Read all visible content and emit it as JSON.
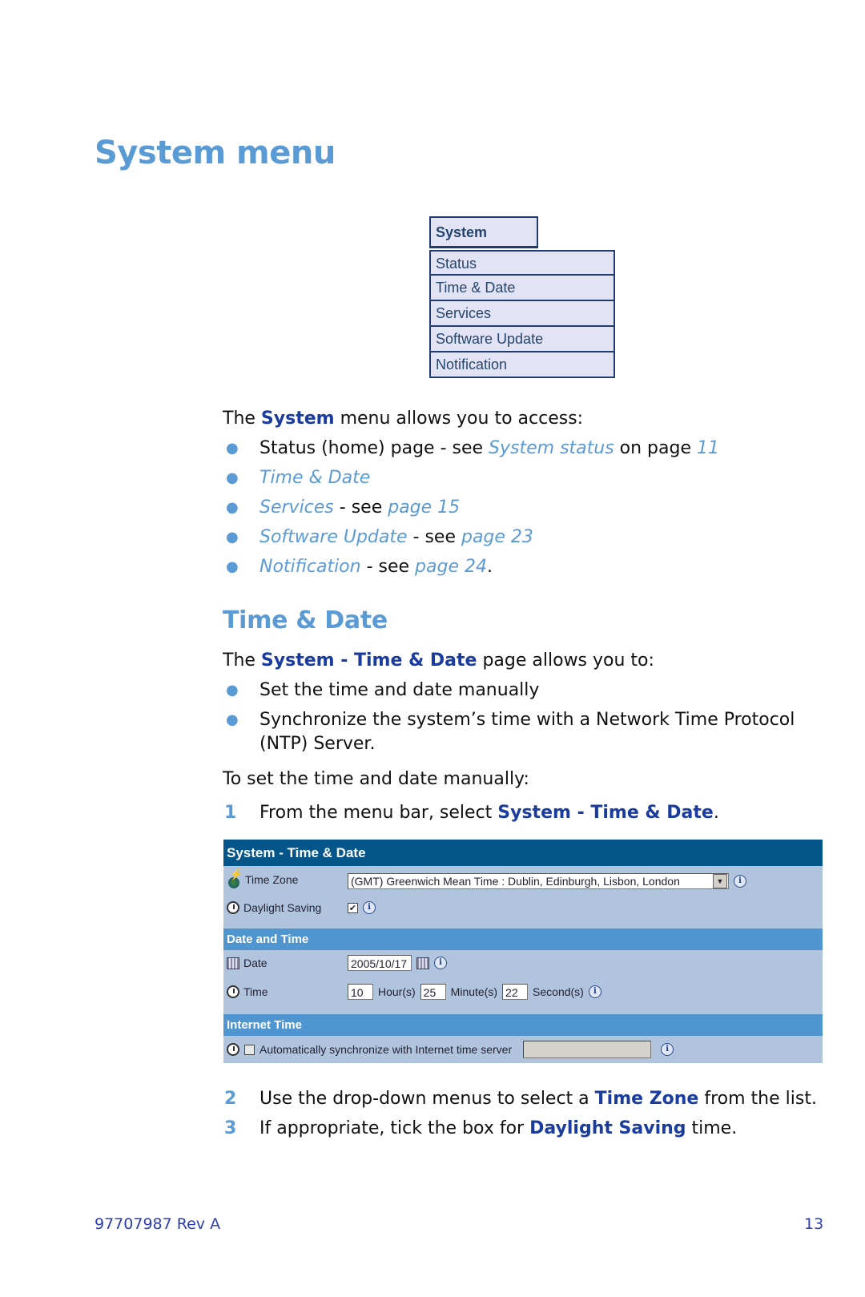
{
  "heading": "System menu",
  "menu": {
    "header": "System",
    "items": [
      "Status",
      "Time & Date",
      "Services",
      "Software Update",
      "Notification"
    ]
  },
  "intro": {
    "pre": "The ",
    "bold": "System",
    "post": " menu allows you to access:"
  },
  "access_list": [
    {
      "text1": "Status (home) page - see ",
      "link1": "System status",
      "text2": " on page ",
      "link2": "11",
      "text3": ""
    },
    {
      "text1": "",
      "link1": "Time & Date",
      "text2": "",
      "link2": "",
      "text3": ""
    },
    {
      "text1": "",
      "link1": "Services",
      "text2": " - see ",
      "link2": "page 15",
      "text3": ""
    },
    {
      "text1": "",
      "link1": "Software Update",
      "text2": " - see ",
      "link2": "page 23",
      "text3": ""
    },
    {
      "text1": "",
      "link1": "Notification",
      "text2": " - see ",
      "link2": "page 24",
      "text3": "."
    }
  ],
  "section": {
    "title": "Time & Date",
    "intro_pre": "The ",
    "intro_bold": "System - Time & Date",
    "intro_post": " page allows you to:",
    "bullets": [
      "Set the time and date manually",
      "Synchronize the system’s time with a Network Time Protocol (NTP) Server."
    ],
    "manual_intro": "To set the time and date manually:",
    "steps": [
      {
        "num": "1",
        "pre": "From the menu bar, select ",
        "bold": "System - Time & Date",
        "post": "."
      },
      {
        "num": "2",
        "pre": "Use the drop-down menus to select a ",
        "bold": "Time Zone",
        "post": " from the list."
      },
      {
        "num": "3",
        "pre": "If appropriate, tick the box for ",
        "bold": "Daylight Saving",
        "post": " time."
      }
    ]
  },
  "panel": {
    "title": "System - Time & Date",
    "timezone_label": "Time Zone",
    "timezone_value": "(GMT) Greenwich Mean Time : Dublin, Edinburgh, Lisbon, London",
    "daylight_label": "Daylight Saving",
    "daylight_checked": true,
    "date_section": "Date and Time",
    "date_label": "Date",
    "date_value": "2005/10/17",
    "time_label": "Time",
    "hour_value": "10",
    "hour_unit": "Hour(s)",
    "minute_value": "25",
    "minute_unit": "Minute(s)",
    "second_value": "22",
    "second_unit": "Second(s)",
    "internet_section": "Internet Time",
    "sync_label": "Automatically synchronize with Internet time server",
    "sync_checked": false,
    "server_value": ""
  },
  "footer": {
    "doc_id": "97707987 Rev A",
    "page": "13"
  }
}
